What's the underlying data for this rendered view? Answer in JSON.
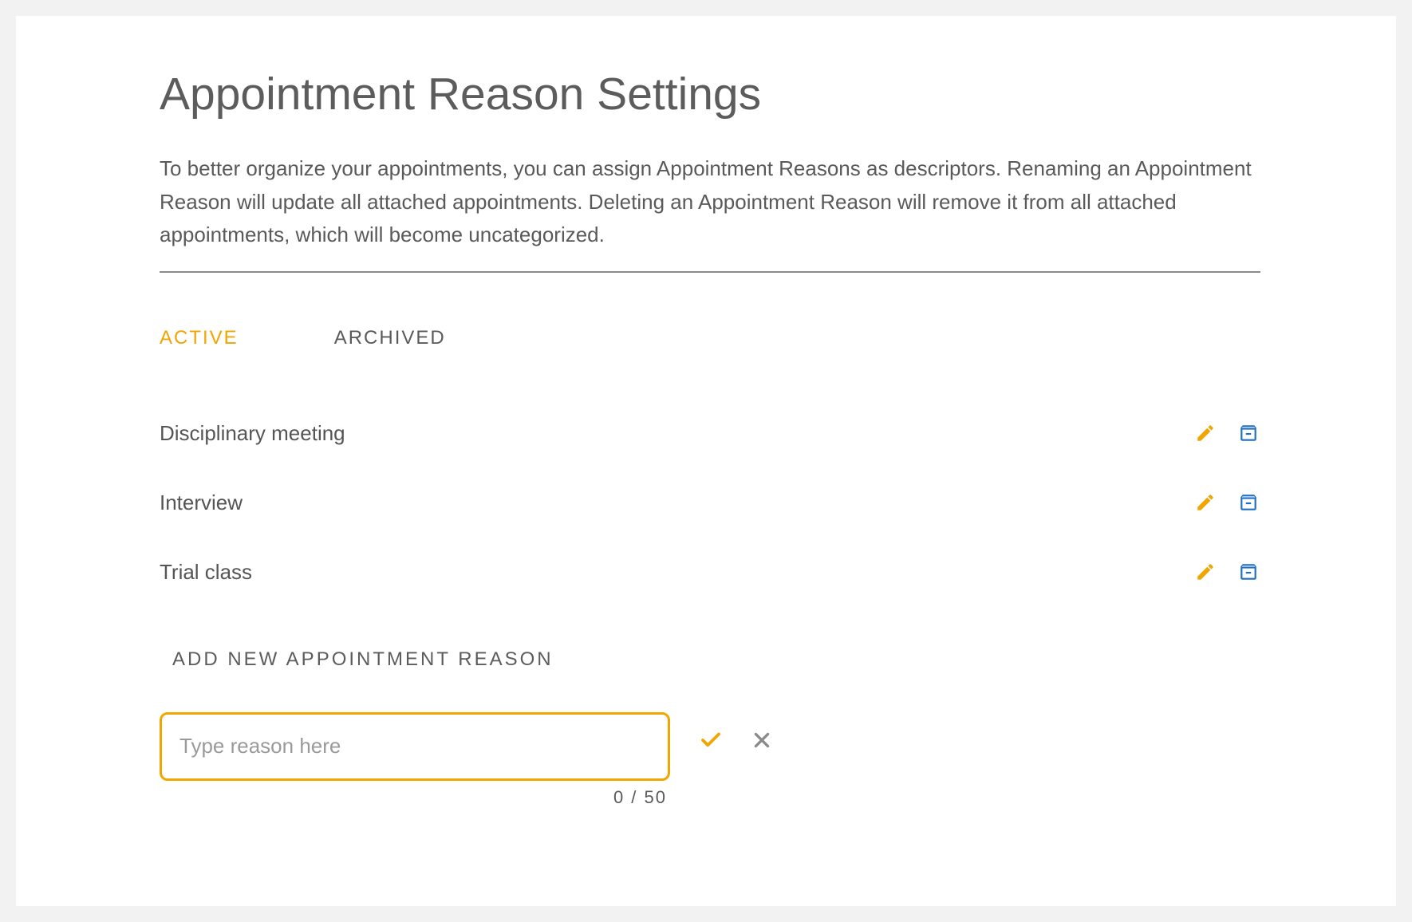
{
  "header": {
    "title": "Appointment Reason Settings",
    "description": "To better organize your appointments, you can assign Appointment Reasons as descriptors. Renaming an Appointment Reason will update all attached appointments. Deleting an Appointment Reason will remove it from all attached appointments, which will become uncategorized."
  },
  "tabs": {
    "active": "ACTIVE",
    "archived": "ARCHIVED"
  },
  "reasons": [
    {
      "label": "Disciplinary meeting"
    },
    {
      "label": "Interview"
    },
    {
      "label": "Trial class"
    }
  ],
  "addSection": {
    "label": "ADD NEW APPOINTMENT REASON",
    "placeholder": "Type reason here",
    "value": "",
    "counter": "0  /  50"
  },
  "colors": {
    "accent": "#f0a500",
    "archiveIcon": "#1f6fc2",
    "text": "#5a5a5a"
  }
}
